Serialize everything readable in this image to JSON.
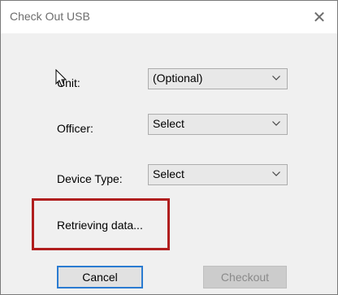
{
  "window": {
    "title": "Check Out USB",
    "close_glyph": "✕"
  },
  "form": {
    "unit_label": "Unit:",
    "unit_value": "(Optional)",
    "officer_label": "Officer:",
    "officer_value": "Select",
    "device_type_label": "Device Type:",
    "device_type_value": "Select"
  },
  "status": {
    "text": "Retrieving data..."
  },
  "buttons": {
    "cancel_label": "Cancel",
    "checkout_label": "Checkout"
  },
  "colors": {
    "highlight": "#b01e1e",
    "focus_border": "#2a7bd1"
  }
}
